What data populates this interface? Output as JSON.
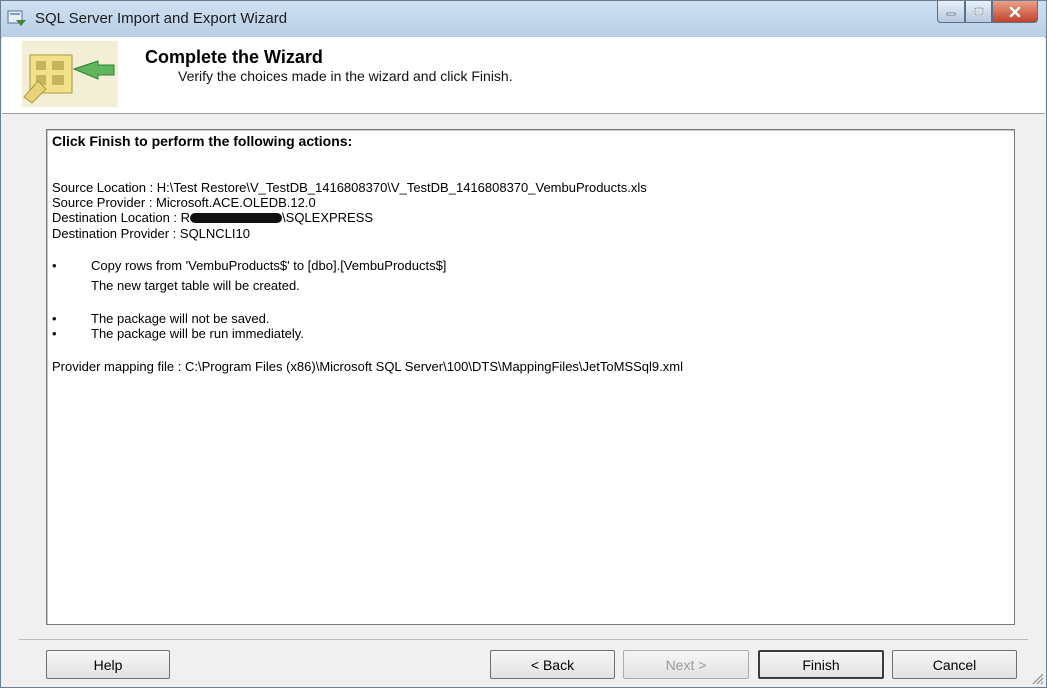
{
  "window": {
    "title": "SQL Server Import and Export Wizard"
  },
  "header": {
    "title": "Complete the Wizard",
    "subtitle": "Verify the choices made in the wizard and click Finish."
  },
  "report": {
    "heading": "Click Finish to perform the following actions:",
    "source_location": "Source Location : H:\\Test Restore\\V_TestDB_1416808370\\V_TestDB_1416808370_VembuProducts.xls",
    "source_provider": "Source Provider : Microsoft.ACE.OLEDB.12.0",
    "destination_location_prefix": "Destination Location : R",
    "destination_location_suffix": "\\SQLEXPRESS",
    "destination_provider": "Destination Provider : SQLNCLI10",
    "bullet_symbol": "•",
    "copy_rows": "Copy rows from 'VembuProducts$' to [dbo].[VembuProducts$]",
    "new_table": "The new target table will be created.",
    "package_not_saved": "The package will not be saved.",
    "package_run": "The package will be run immediately.",
    "provider_mapping": "Provider mapping file : C:\\Program Files (x86)\\Microsoft SQL Server\\100\\DTS\\MappingFiles\\JetToMSSql9.xml"
  },
  "buttons": {
    "help": "Help",
    "back": "< Back",
    "next": "Next >",
    "finish": "Finish",
    "cancel": "Cancel"
  },
  "icons": {
    "app": "wizard-app-icon",
    "header": "import-export-wizard-icon",
    "minimize": "minimize-icon",
    "maximize": "maximize-icon",
    "close": "close-icon"
  }
}
